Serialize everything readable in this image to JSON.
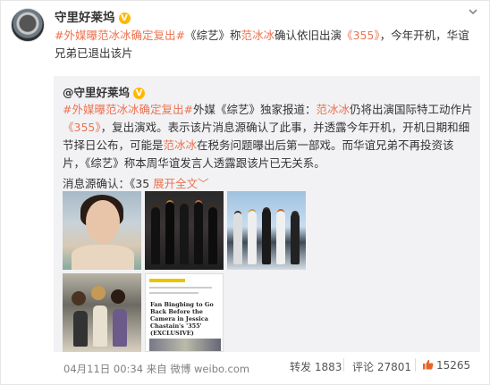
{
  "post": {
    "author": "守里好莱坞",
    "verified_badge": "V",
    "menu_icon": "chevron-down-icon",
    "text_parts": [
      {
        "t": "#外媒曝",
        "c": "link"
      },
      {
        "t": "范冰冰",
        "c": "orange"
      },
      {
        "t": "确定复出#",
        "c": "link"
      },
      {
        "t": "《综艺》称",
        "c": ""
      },
      {
        "t": "范冰冰",
        "c": "orange"
      },
      {
        "t": "确认依旧出演",
        "c": ""
      },
      {
        "t": "《355》",
        "c": "link"
      },
      {
        "t": "，今年开机，华谊兄弟已退出该片",
        "c": ""
      }
    ]
  },
  "repost": {
    "author": "@守里好莱坞",
    "verified_badge": "V",
    "text_parts": [
      {
        "t": "#外媒曝",
        "c": "link"
      },
      {
        "t": "范冰冰",
        "c": "orange"
      },
      {
        "t": "确定复出#",
        "c": "link"
      },
      {
        "t": "外媒《综艺》独家报道：",
        "c": ""
      },
      {
        "t": "范冰冰",
        "c": "orange"
      },
      {
        "t": "仍将出演国际特工动作片",
        "c": ""
      },
      {
        "t": "《355》",
        "c": "link"
      },
      {
        "t": "，复出演戏。表示该片消息源确认了此事，并透露今年开机，开机日期和细节择日公布，可能是",
        "c": ""
      },
      {
        "t": "范冰冰",
        "c": "orange"
      },
      {
        "t": "在税务问题曝出后第一部戏。而华谊兄弟不再投资该片，《综艺》称本周华谊发言人透露跟该片已无关系。",
        "c": ""
      }
    ],
    "source_prefix": "消息源确认：《35",
    "expand_label": "展开全文",
    "expand_arrow": "﹀",
    "article": {
      "title": "Fan Bingbing to Go Back Before the Camera in Jessica Chastain's '355' (EXCLUSIVE)"
    }
  },
  "footer": {
    "meta": "04月11日 00:34 来自 微博 weibo.com",
    "repost_label": "转发",
    "repost_count": "1883",
    "comment_label": "评论",
    "comment_count": "27801",
    "like_count": "15265",
    "like_icon": "thumbs-up-icon"
  },
  "colors": {
    "link": "#eb7350",
    "text": "#333333",
    "meta": "#808080",
    "repost_bg": "#f2f2f5",
    "verified": "#ffb900"
  }
}
